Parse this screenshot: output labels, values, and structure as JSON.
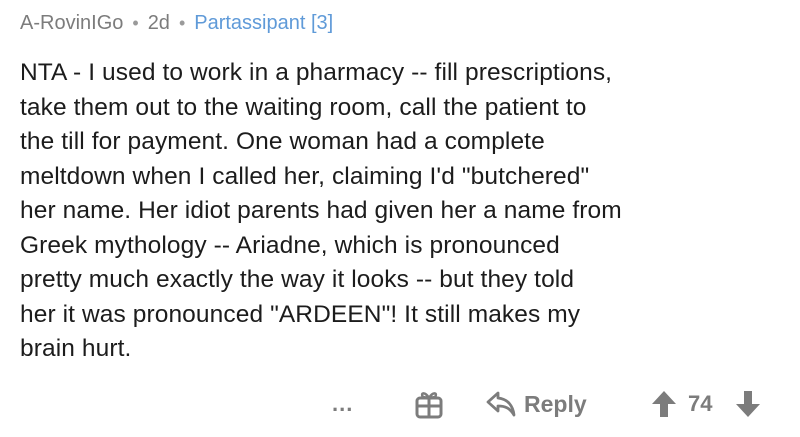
{
  "comment": {
    "author": "A-RovinIGo",
    "separator": "•",
    "age": "2d",
    "flair": "Partassipant [3]",
    "body": "NTA - I used to work in a pharmacy -- fill prescriptions,\ntake them out to the waiting room, call the patient to\nthe till for payment. One woman had a complete\nmeltdown when I called her, claiming I'd \"butchered\"\nher name. Her idiot parents had given her a name from\nGreek mythology -- Ariadne, which is pronounced\npretty much exactly the way it looks -- but  they told\nher it was pronounced \"ARDEEN\"! It still makes my\nbrain hurt."
  },
  "actions": {
    "more_label": "...",
    "award_icon": "gift-icon",
    "reply_icon": "reply-arrow-icon",
    "reply_label": "Reply",
    "upvote_icon": "upvote-arrow-icon",
    "score": "74",
    "downvote_icon": "downvote-arrow-icon"
  },
  "colors": {
    "meta_text": "#7c7c7c",
    "flair": "#5f9ad8",
    "body_text": "#1c1c1c",
    "action_text": "#7c7c7c"
  }
}
